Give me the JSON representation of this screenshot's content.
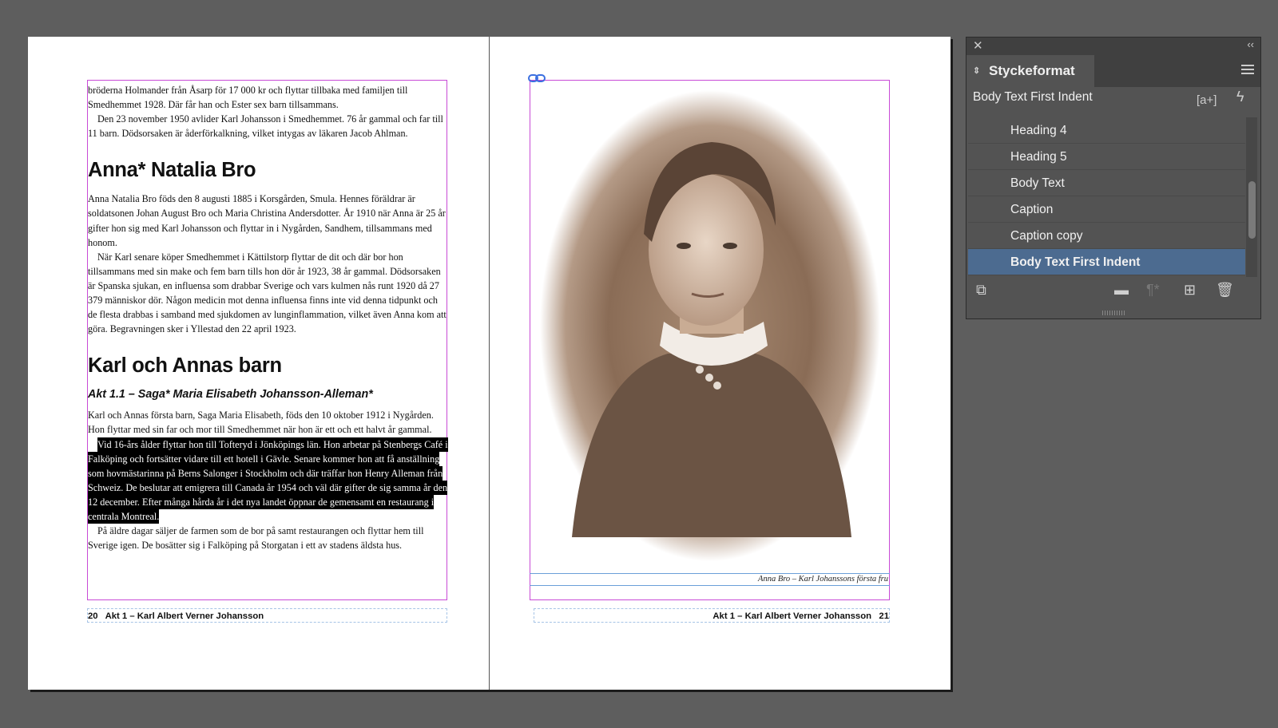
{
  "left_page": {
    "para_1": "bröderna Holmander från Åsarp för 17 000 kr och flyttar tillbaka med familjen till Smedhemmet 1928. Där får han och Ester sex barn tillsammans.",
    "para_2": "Den 23 november 1950 avlider Karl Johansson i Smedhemmet. 76 år gammal och far till 11 barn. Dödsorsaken är åderförkalkning, vilket intygas av läkaren Jacob Ahlman.",
    "heading_1": "Anna* Natalia Bro",
    "para_3": "Anna Natalia Bro föds den 8 augusti 1885 i Korsgården, Smula. Hennes föräldrar är soldatsonen Johan August Bro och Maria Christina Andersdotter. År 1910 när Anna är 25 år gifter hon sig med Karl Johansson och flyttar in i Nygården, Sandhem, tillsammans med honom.",
    "para_4": "När Karl senare köper Smedhemmet i Kättilstorp flyttar de dit och där bor hon tillsammans med sin make och fem barn tills hon dör år 1923, 38 år gammal. Dödsorsaken är Spanska sjukan, en influensa som drabbar Sverige och vars kulmen nås runt 1920 då 27 379 människor dör. Någon medicin mot denna influensa finns inte vid denna tidpunkt och de flesta drabbas i samband med sjukdomen av lunginflammation, vilket även Anna kom att göra. Begravningen sker i Yllestad den 22 april 1923.",
    "heading_2": "Karl och Annas barn",
    "subheading": "Akt 1.1 – Saga* Maria Elisabeth Johansson-Alleman*",
    "para_5": "Karl och Annas första barn, Saga Maria Elisabeth, föds den 10 oktober 1912 i Nygården.  Hon flyttar med sin far och mor till Smedhemmet när hon är ett och ett halvt år gammal.",
    "para_6_selected": "Vid 16-års ålder flyttar hon till Tofteryd i Jönköpings län. Hon arbetar på Stenbergs Café i Falköping och fortsätter vidare till ett hotell i Gävle. Senare kommer hon att få anställning som hovmästarinna på Berns Salonger i Stockholm och där träffar hon Henry Alleman från Schweiz. De beslutar att emigrera till Canada år 1954 och väl där gifter de sig samma år den 12 december. Efter många hårda år i det nya landet öppnar de gemensamt en restaurang i centrala Montreal.",
    "para_7": "På äldre dagar säljer de farmen som de bor på samt restaurangen och flyttar hem till Sverige igen. De bosätter sig i Falköping på Storgatan i ett av stadens äldsta hus.",
    "folio_number": "20",
    "folio_text": "Akt 1 – Karl Albert Verner Johansson"
  },
  "right_page": {
    "caption": "Anna Bro – Karl Johanssons första fru",
    "folio_text": "Akt 1 – Karl Albert Verner Johansson",
    "folio_number": "21"
  },
  "panel": {
    "title": "Styckeformat",
    "current_style": "Body Text First Indent",
    "new_level_label": "[a+]",
    "styles": [
      "Heading 4",
      "Heading 5",
      "Body Text",
      "Caption",
      "Caption copy",
      "Body Text First Indent"
    ],
    "selected_index": 5,
    "icons": [
      "close-icon",
      "collapse-icon",
      "panel-menu-icon",
      "lightning-icon",
      "load-styles-icon",
      "new-group-icon",
      "clear-overrides-icon",
      "new-style-icon",
      "delete-icon"
    ]
  }
}
